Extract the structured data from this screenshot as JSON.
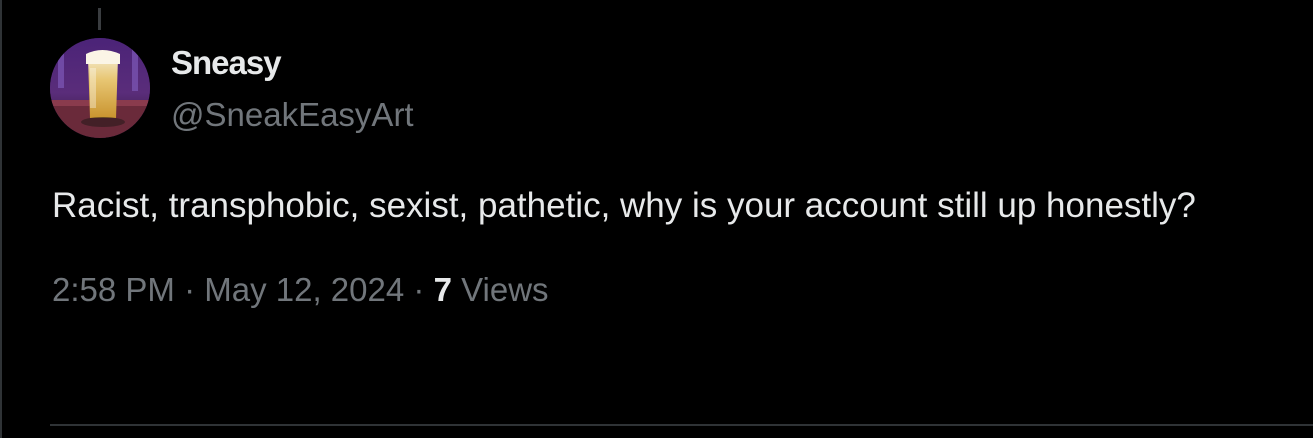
{
  "tweet": {
    "author": {
      "display_name": "Sneasy",
      "handle": "@SneakEasyArt"
    },
    "text": "Racist, transphobic, sexist, pathetic, why is your account still up honestly?",
    "time": "2:58 PM",
    "separator": "·",
    "date": "May 12, 2024",
    "views_count": "7",
    "views_label": "Views"
  },
  "colors": {
    "background": "#000000",
    "primary_text": "#e7e9ea",
    "secondary_text": "#71767b",
    "divider": "#2f3336"
  }
}
